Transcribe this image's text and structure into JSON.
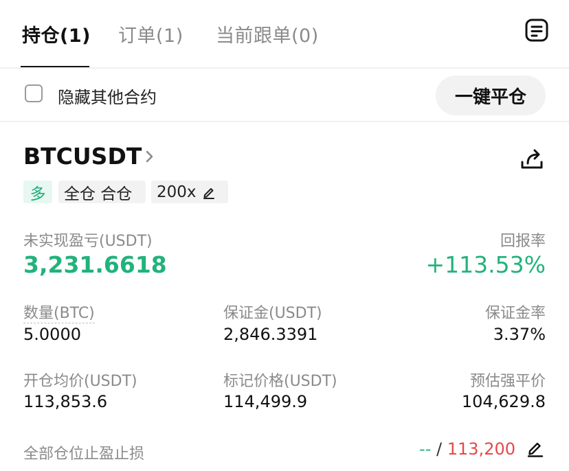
{
  "tabs": [
    {
      "label": "持仓(1)",
      "active": true
    },
    {
      "label": "订单(1)",
      "active": false
    },
    {
      "label": "当前跟单(0)",
      "active": false
    }
  ],
  "filter": {
    "hide_other_label": "隐藏其他合约",
    "hide_other_checked": false,
    "close_all_label": "一键平仓"
  },
  "position": {
    "symbol": "BTCUSDT",
    "side": "多",
    "margin_mode": "全仓 合仓",
    "leverage": "200x",
    "unrealized_pnl_label": "未实现盈亏(USDT)",
    "unrealized_pnl": "3,231.6618",
    "roi_label": "回报率",
    "roi": "+113.53%",
    "size_label": "数量(BTC)",
    "size": "5.0000",
    "margin_label": "保证金(USDT)",
    "margin": "2,846.3391",
    "margin_ratio_label": "保证金率",
    "margin_ratio": "3.37%",
    "entry_price_label": "开仓均价(USDT)",
    "entry_price": "113,853.6",
    "mark_price_label": "标记价格(USDT)",
    "mark_price": "114,499.9",
    "liq_price_label": "预估强平价",
    "liq_price": "104,629.8",
    "tpsl_label": "全部仓位止盈止损",
    "tp_value": "--",
    "tpsl_separator": "/",
    "sl_value": "113,200"
  },
  "colors": {
    "profit": "#22b27c",
    "loss": "#e6484a",
    "muted": "#8a8a8a"
  },
  "icons": [
    "orders-icon",
    "chevron-right-icon",
    "share-icon",
    "edit-icon"
  ]
}
